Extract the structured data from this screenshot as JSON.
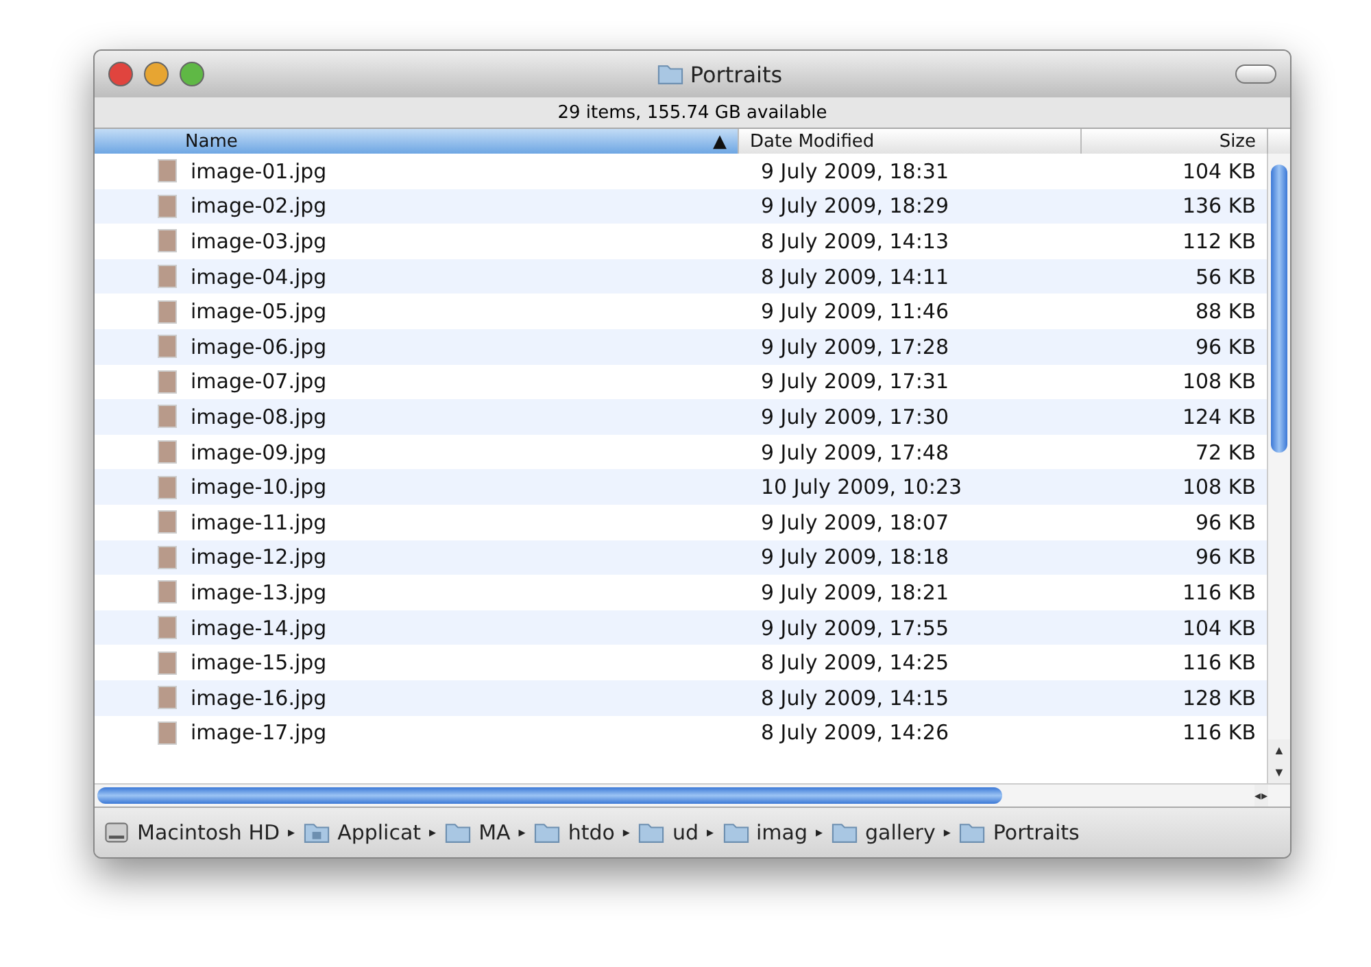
{
  "window": {
    "title": "Portraits"
  },
  "status": "29 items, 155.74 GB available",
  "columns": [
    {
      "label": "Name",
      "selected": true,
      "sort": "▲"
    },
    {
      "label": "Date Modified",
      "selected": false
    },
    {
      "label": "Size",
      "selected": false
    }
  ],
  "rows": [
    {
      "name": "image-01.jpg",
      "date": "9 July 2009, 18:31",
      "size": "104 KB"
    },
    {
      "name": "image-02.jpg",
      "date": "9 July 2009, 18:29",
      "size": "136 KB"
    },
    {
      "name": "image-03.jpg",
      "date": "8 July 2009, 14:13",
      "size": "112 KB"
    },
    {
      "name": "image-04.jpg",
      "date": "8 July 2009, 14:11",
      "size": "56 KB"
    },
    {
      "name": "image-05.jpg",
      "date": "9 July 2009, 11:46",
      "size": "88 KB"
    },
    {
      "name": "image-06.jpg",
      "date": "9 July 2009, 17:28",
      "size": "96 KB"
    },
    {
      "name": "image-07.jpg",
      "date": "9 July 2009, 17:31",
      "size": "108 KB"
    },
    {
      "name": "image-08.jpg",
      "date": "9 July 2009, 17:30",
      "size": "124 KB"
    },
    {
      "name": "image-09.jpg",
      "date": "9 July 2009, 17:48",
      "size": "72 KB"
    },
    {
      "name": "image-10.jpg",
      "date": "10 July 2009, 10:23",
      "size": "108 KB"
    },
    {
      "name": "image-11.jpg",
      "date": "9 July 2009, 18:07",
      "size": "96 KB"
    },
    {
      "name": "image-12.jpg",
      "date": "9 July 2009, 18:18",
      "size": "96 KB"
    },
    {
      "name": "image-13.jpg",
      "date": "9 July 2009, 18:21",
      "size": "116 KB"
    },
    {
      "name": "image-14.jpg",
      "date": "9 July 2009, 17:55",
      "size": "104 KB"
    },
    {
      "name": "image-15.jpg",
      "date": "8 July 2009, 14:25",
      "size": "116 KB"
    },
    {
      "name": "image-16.jpg",
      "date": "8 July 2009, 14:15",
      "size": "128 KB"
    },
    {
      "name": "image-17.jpg",
      "date": "8 July 2009, 14:26",
      "size": "116 KB"
    }
  ],
  "path": [
    {
      "label": "Macintosh HD",
      "kind": "disk"
    },
    {
      "label": "Applicat",
      "kind": "apps"
    },
    {
      "label": "MA",
      "kind": "folder"
    },
    {
      "label": "htdo",
      "kind": "folder"
    },
    {
      "label": "ud",
      "kind": "folder"
    },
    {
      "label": "imag",
      "kind": "folder"
    },
    {
      "label": "gallery",
      "kind": "folder"
    },
    {
      "label": "Portraits",
      "kind": "folder"
    }
  ],
  "path_separator": "▸",
  "scroll_arrows": {
    "up": "▲",
    "down": "▼",
    "left": "◂",
    "right": "▸"
  }
}
